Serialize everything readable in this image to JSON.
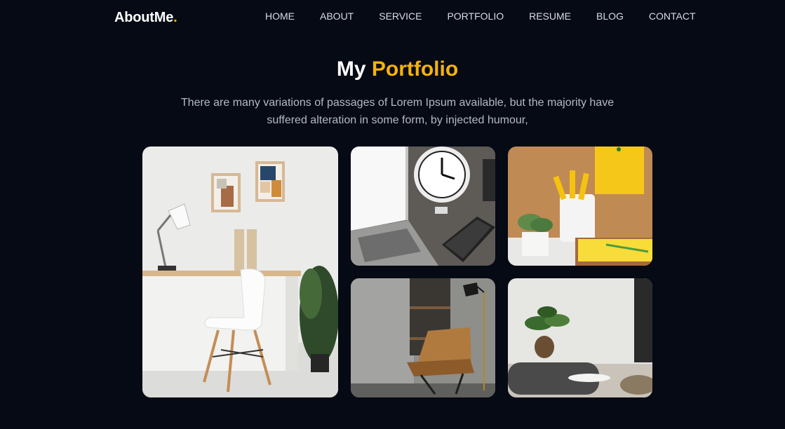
{
  "header": {
    "logo_main": "AboutMe",
    "logo_accent": ".",
    "nav": [
      "HOME",
      "ABOUT",
      "SERVICE",
      "PORTFOLIO",
      "RESUME",
      "BLOG",
      "CONTACT"
    ]
  },
  "section": {
    "title_main": "My",
    "title_accent": "Portfolio",
    "description": "There are many variations of passages of Lorem Ipsum available, but the majority have suffered alteration in some form, by injected humour,"
  },
  "colors": {
    "accent": "#f5b30a",
    "background": "#050a14"
  },
  "portfolio_items": [
    {
      "image": "white-desk-chair-room-photo"
    },
    {
      "image": "laptop-alarm-clock-desk-photo"
    },
    {
      "image": "pencil-cup-corkboard-photo"
    },
    {
      "image": "leather-armchair-floor-lamp-photo"
    },
    {
      "image": "plant-pouf-living-room-photo"
    }
  ]
}
